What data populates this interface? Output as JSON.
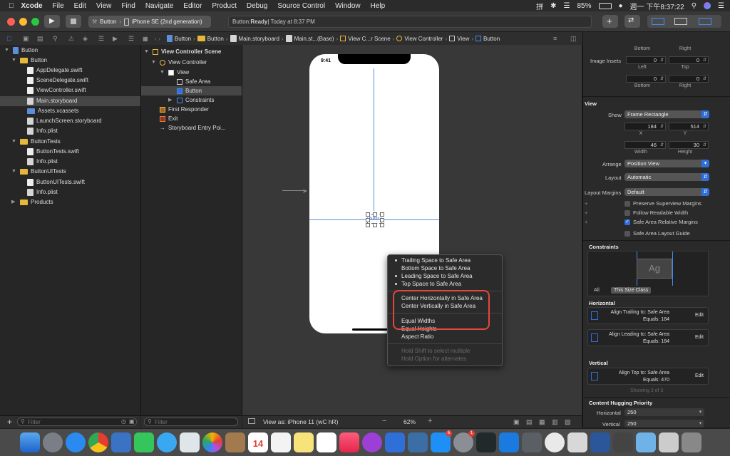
{
  "menubar": {
    "app": "Xcode",
    "items": [
      "File",
      "Edit",
      "View",
      "Find",
      "Navigate",
      "Editor",
      "Product",
      "Debug",
      "Source Control",
      "Window",
      "Help"
    ],
    "battery": "85%",
    "clock": "週一 下午8:37:22"
  },
  "toolbar": {
    "scheme_target": "Button",
    "scheme_device": "iPhone SE (2nd generation)",
    "status_prefix": "Button: ",
    "status_bold": "Ready",
    "status_suffix": " | Today at 8:37 PM"
  },
  "jumpbar": [
    "Button",
    "Button",
    "Main.storyboard",
    "Main.st...(Base)",
    "View C...r Scene",
    "View Controller",
    "View",
    "Button"
  ],
  "navigator": {
    "items": [
      {
        "label": "Button",
        "type": "project"
      },
      {
        "label": "Button",
        "type": "folder"
      },
      {
        "label": "AppDelegate.swift",
        "type": "swift"
      },
      {
        "label": "SceneDelegate.swift",
        "type": "swift"
      },
      {
        "label": "ViewController.swift",
        "type": "swift"
      },
      {
        "label": "Main.storyboard",
        "type": "storyboard"
      },
      {
        "label": "Assets.xcassets",
        "type": "folder"
      },
      {
        "label": "LaunchScreen.storyboard",
        "type": "storyboard"
      },
      {
        "label": "Info.plist",
        "type": "plist"
      },
      {
        "label": "ButtonTests",
        "type": "folder"
      },
      {
        "label": "ButtonTests.swift",
        "type": "swift"
      },
      {
        "label": "Info.plist",
        "type": "plist"
      },
      {
        "label": "ButtonUITests",
        "type": "folder"
      },
      {
        "label": "ButtonUITests.swift",
        "type": "swift"
      },
      {
        "label": "Info.plist",
        "type": "plist"
      },
      {
        "label": "Products",
        "type": "folder"
      }
    ],
    "filter_placeholder": "Filter"
  },
  "outline": {
    "items": [
      "View Controller Scene",
      "View Controller",
      "View",
      "Safe Area",
      "Button",
      "Constraints",
      "First Responder",
      "Exit",
      "Storyboard Entry Poi..."
    ],
    "filter_placeholder": "Filter"
  },
  "canvas": {
    "time": "9:41",
    "button_label": "Button",
    "view_as": "View as: iPhone 11 (wC hR)",
    "zoom": "62%"
  },
  "popup": {
    "group1": [
      "Trailing Space to Safe Area",
      "Bottom Space to Safe Area",
      "Leading Space to Safe Area",
      "Top Space to Safe Area"
    ],
    "group2": [
      "Center Horizontally in Safe Area",
      "Center Vertically in Safe Area"
    ],
    "group3": [
      "Equal Widths",
      "Equal Heights",
      "Aspect Ratio"
    ],
    "hints": [
      "Hold Shift to select multiple",
      "Hold Option for alternates"
    ]
  },
  "inspector": {
    "top_labels": {
      "bottom1": "Bottom",
      "right1": "Right",
      "image_insets": "Image Insets",
      "inset_left": "0",
      "inset_top": "0",
      "left_lbl": "Left",
      "top_lbl": "Top",
      "inset_bottom": "0",
      "inset_right": "0",
      "bottom2": "Bottom",
      "right2": "Right"
    },
    "view_section": "View",
    "show_label": "Show",
    "show_value": "Frame Rectangle",
    "x": "184",
    "y": "514",
    "x_lbl": "X",
    "y_lbl": "Y",
    "width": "46",
    "height": "30",
    "width_lbl": "Width",
    "height_lbl": "Height",
    "arrange_label": "Arrange",
    "arrange_value": "Position View",
    "layout_label": "Layout",
    "layout_value": "Automatic",
    "margins_label": "Layout Margins",
    "margins_value": "Default",
    "checks": [
      "Preserve Superview Margins",
      "Follow Readable Width",
      "Safe Area Relative Margins",
      "Safe Area Layout Guide"
    ],
    "constraints_section": "Constraints",
    "ag": "Ag",
    "size_tabs": [
      "All",
      "This Size Class"
    ],
    "horizontal": "Horizontal",
    "h1_title": "Align Trailing to:  Safe Area",
    "h1_eq": "Equals:  184",
    "h2_title": "Align Leading to:  Safe Area",
    "h2_eq": "Equals:  184",
    "vertical": "Vertical",
    "v1_title": "Align Top to:  Safe Area",
    "v1_eq": "Equals:  470",
    "edit": "Edit",
    "showing": "Showing 3 of 3",
    "hugging": "Content Hugging Priority",
    "hug_h_label": "Horizontal",
    "hug_h_value": "250",
    "hug_v_label": "Vertical",
    "hug_v_value": "250"
  },
  "dock": {
    "calendar_day": "14",
    "badge_appstore": "6",
    "badge_prefs": "1"
  }
}
